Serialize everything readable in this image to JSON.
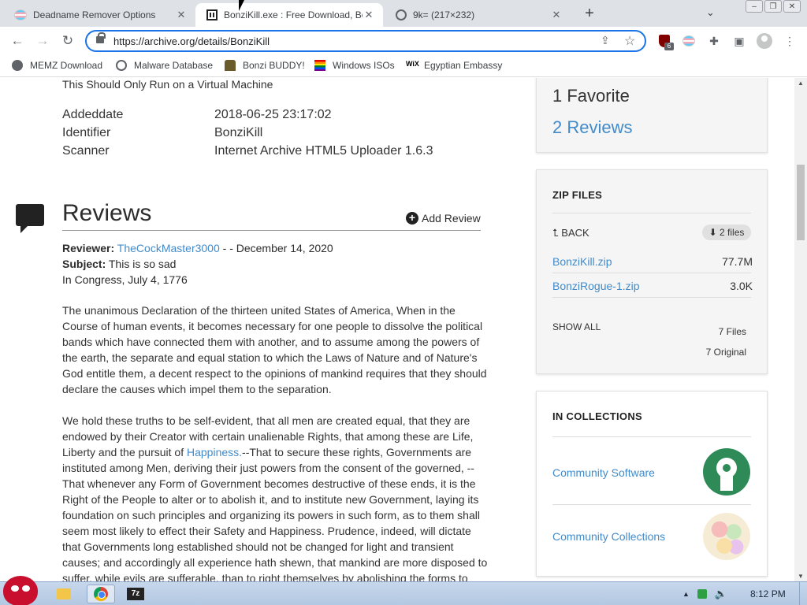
{
  "browser": {
    "tabs": [
      {
        "title": "Deadname Remover Options",
        "close": "✕"
      },
      {
        "title": "BonziKill.exe : Free Download, Bo",
        "close": "✕"
      },
      {
        "title": "9k= (217×232)",
        "close": "✕"
      }
    ],
    "new_tab": "+",
    "url": "https://archive.org/details/BonziKill",
    "extension_badge": "6",
    "bookmarks": [
      {
        "label": "MEMZ Download",
        "icon": "memz-icon"
      },
      {
        "label": "Malware Database",
        "icon": "globe-icon"
      },
      {
        "label": "Bonzi BUDDY!",
        "icon": "bonzi-icon"
      },
      {
        "label": "Windows ISOs",
        "icon": "rainbow-flag-icon"
      },
      {
        "label": "Egyptian Embassy",
        "icon": "wix-icon"
      }
    ]
  },
  "page": {
    "description_tail": "This Should Only Run on a Virtual Machine",
    "metadata": [
      {
        "key": "Addeddate",
        "value": "2018-06-25 23:17:02"
      },
      {
        "key": "Identifier",
        "value": "BonziKill"
      },
      {
        "key": "Scanner",
        "value": "Internet Archive HTML5 Uploader 1.6.3"
      }
    ],
    "reviews_heading": "Reviews",
    "add_review": "Add Review",
    "review": {
      "reviewer_label": "Reviewer:",
      "reviewer": "TheCockMaster3000",
      "date": " - - December 14, 2020",
      "subject_label": "Subject:",
      "subject": "This is so sad",
      "line3": "In Congress, July 4, 1776",
      "para1": "The unanimous Declaration of the thirteen united States of America, When in the Course of human events, it becomes necessary for one people to dissolve the political bands which have connected them with another, and to assume among the powers of the earth, the separate and equal station to which the Laws of Nature and of Nature's God entitle them, a decent respect to the opinions of mankind requires that they should declare the causes which impel them to the separation.",
      "para2_a": "We hold these truths to be self-evident, that all men are created equal, that they are endowed by their Creator with certain unalienable Rights, that among these are Life, Liberty and the pursuit of ",
      "para2_link": "Happiness.",
      "para2_b": "--That to secure these rights, Governments are instituted among Men, deriving their just powers from the consent of the governed, --That whenever any Form of Government becomes destructive of these ends, it is the Right of the People to alter or to abolish it, and to institute new Government, laying its foundation on such principles and organizing its powers in such form, as to them shall seem most likely to effect their Safety and Happiness. Prudence, indeed, will dictate that Governments long established should not be changed for light and transient causes; and accordingly all experience hath shewn, that mankind are more disposed to suffer, while evils are sufferable, than to right themselves by abolishing the forms to"
    }
  },
  "sidebar": {
    "favorites": "1 Favorite",
    "reviews": "2 Reviews",
    "zip_heading": "ZIP FILES",
    "back": "BACK",
    "files_badge": "2 files",
    "files": [
      {
        "name": "BonziKill.zip",
        "size": "77.7M"
      },
      {
        "name": "BonziRogue-1.zip",
        "size": "3.0K"
      }
    ],
    "show_all": "SHOW ALL",
    "total_files": "7 Files",
    "total_original": "7 Original",
    "collections_heading": "IN COLLECTIONS",
    "collections": [
      {
        "name": "Community Software"
      },
      {
        "name": "Community Collections"
      }
    ]
  },
  "taskbar": {
    "clock": "8:12 PM",
    "sevenzip_label": "7z"
  },
  "colors": {
    "link": "#428bca",
    "omnibox_border": "#1a73e8"
  }
}
